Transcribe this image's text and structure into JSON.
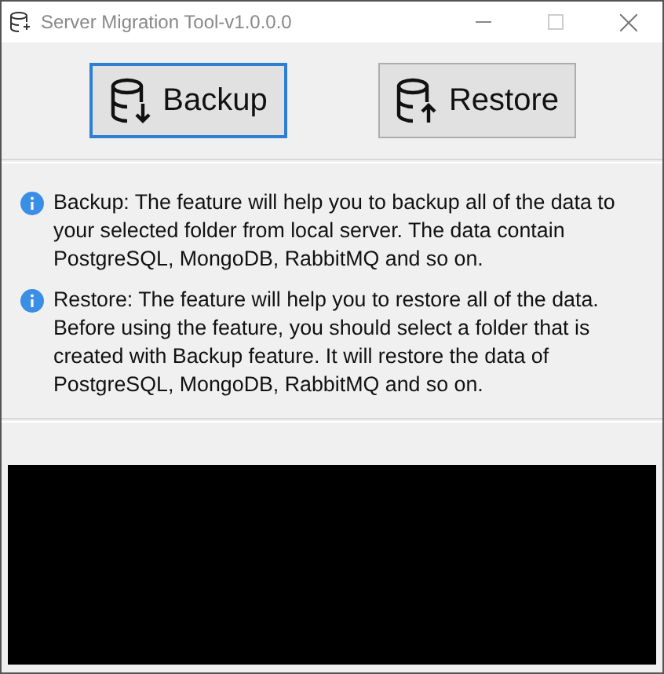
{
  "window": {
    "title": "Server Migration Tool-v1.0.0.0"
  },
  "buttons": [
    {
      "label": "Backup",
      "kind": "backup",
      "focused": true
    },
    {
      "label": "Restore",
      "kind": "restore",
      "focused": false
    }
  ],
  "notes": [
    "Backup: The feature will help you to backup all of the data to your selected folder from local server. The data contain PostgreSQL, MongoDB, RabbitMQ and so on.",
    "Restore: The feature will help you to restore all of the data. Before using the feature, you should select a folder that is created with Backup feature. It will restore the data of PostgreSQL, MongoDB, RabbitMQ and so on."
  ]
}
